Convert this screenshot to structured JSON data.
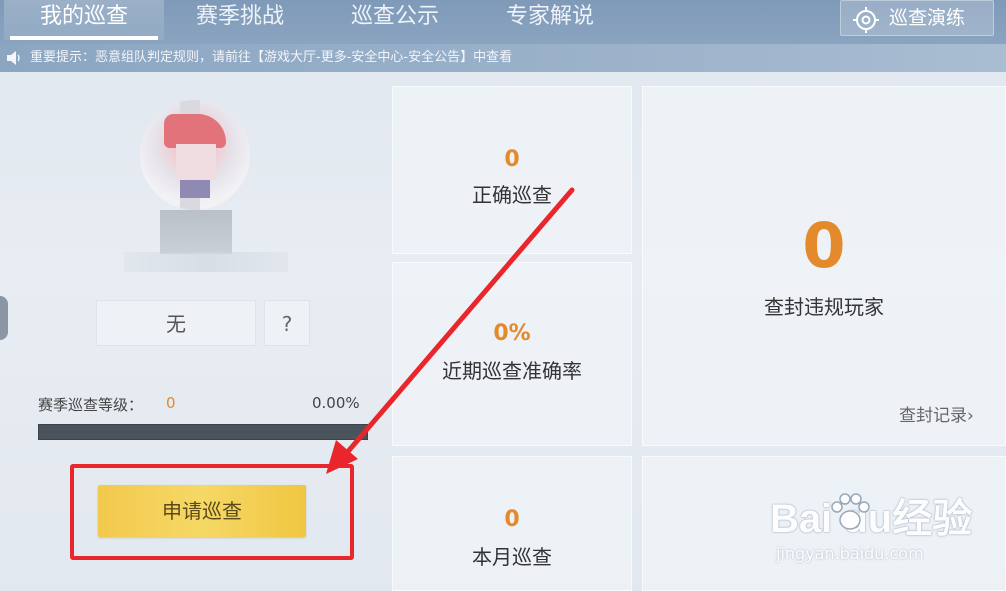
{
  "nav": {
    "tabs": [
      {
        "label": "我的巡查",
        "active": true
      },
      {
        "label": "赛季挑战",
        "active": false
      },
      {
        "label": "巡查公示",
        "active": false
      },
      {
        "label": "专家解说",
        "active": false
      }
    ],
    "drill_button": {
      "label": "巡查演练",
      "icon": "target-icon"
    }
  },
  "notice": {
    "icon": "speaker-icon",
    "text": "重要提示：恶意组队判定规则，请前往【游戏大厅-更多-安全中心-安全公告】中查看"
  },
  "profile": {
    "title_badge": "无",
    "help": "?",
    "season_level_label": "赛季巡查等级：",
    "season_level_value": "0",
    "progress_text": "0.00%",
    "progress_value": 0.0,
    "apply_button": "申请巡查"
  },
  "stats": {
    "correct_patrols": {
      "value": "0",
      "label": "正确巡查"
    },
    "recent_accuracy": {
      "value": "0%",
      "label": "近期巡查准确率"
    },
    "monthly_patrols": {
      "value": "0",
      "label": "本月巡查"
    },
    "banned_players": {
      "value": "0",
      "label": "查封违规玩家",
      "link": "查封记录"
    }
  },
  "watermark": {
    "brand": "Bai  du经验",
    "url": "jingyan.baidu.com"
  },
  "colors": {
    "accent": "#e48a2c",
    "annotation": "#e8262c",
    "button": "#f2c94c",
    "nav": "#7f9ab8"
  }
}
